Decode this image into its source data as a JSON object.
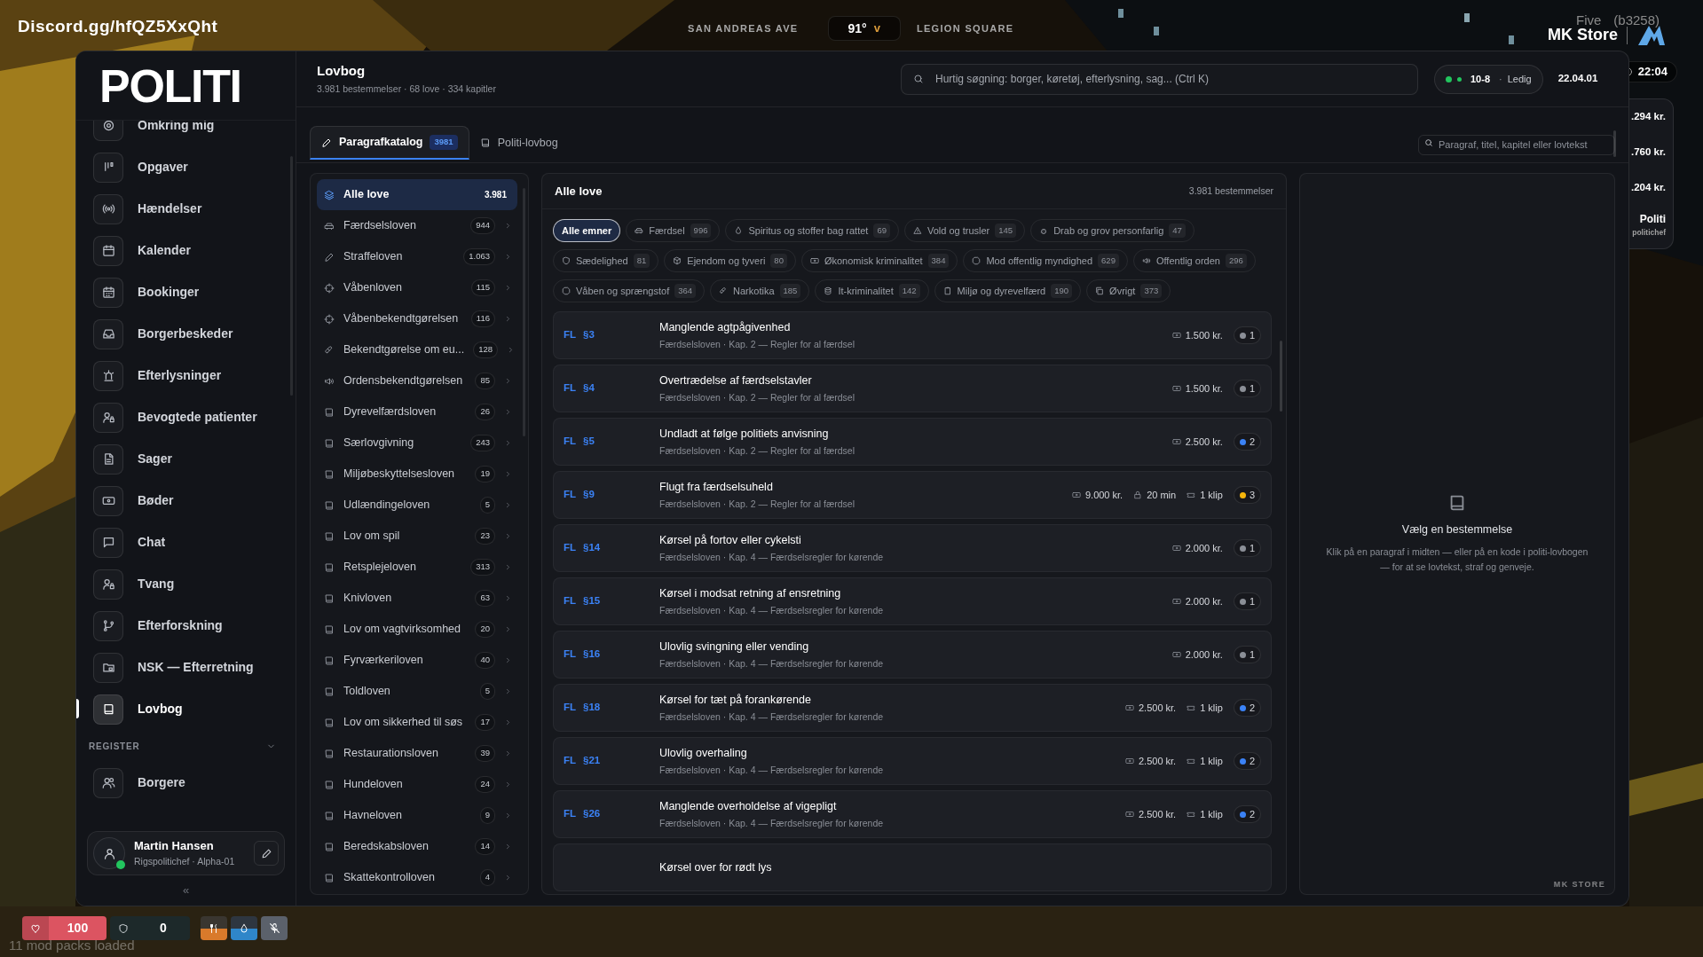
{
  "hud": {
    "server_link": "Discord.gg/hfQZ5XxQht",
    "street": "SAN ANDREAS AVE",
    "temperature": "91°",
    "temperature_unit": "v",
    "zone": "LEGION SQUARE",
    "client_name_fragment": "Five",
    "client_build": "(b3258)",
    "store_name": "MK Store",
    "clock": "22:04",
    "side_cards": [
      ".294 kr.",
      ".760 kr.",
      ".204 kr."
    ],
    "side_profile": {
      "name": "Politi",
      "role": "politichef"
    },
    "vitals": [
      {
        "kind": "health",
        "value": "100"
      },
      {
        "kind": "armor",
        "value": "0"
      },
      {
        "kind": "hunger"
      },
      {
        "kind": "thirst"
      },
      {
        "kind": "voice"
      }
    ],
    "loader_status": "11 mod packs loaded"
  },
  "sidebar": {
    "logo": "POLITI",
    "items": [
      {
        "label": "Omkring mig",
        "selected": false
      },
      {
        "label": "Opgaver",
        "selected": false
      },
      {
        "label": "Hændelser",
        "selected": false
      },
      {
        "label": "Kalender",
        "selected": false
      },
      {
        "label": "Bookinger",
        "selected": false
      },
      {
        "label": "Borgerbeskeder",
        "selected": false
      },
      {
        "label": "Efterlysninger",
        "selected": false
      },
      {
        "label": "Bevogtede patienter",
        "selected": false
      },
      {
        "label": "Sager",
        "selected": false
      },
      {
        "label": "Bøder",
        "selected": false
      },
      {
        "label": "Chat",
        "selected": false
      },
      {
        "label": "Tvang",
        "selected": false
      },
      {
        "label": "Efterforskning",
        "selected": false
      },
      {
        "label": "NSK — Efterretning",
        "selected": false
      },
      {
        "label": "Lovbog",
        "selected": true
      }
    ],
    "section": {
      "title": "REGISTER",
      "expanded": true,
      "items": [
        {
          "label": "Borgere",
          "selected": false
        }
      ]
    },
    "user": {
      "name": "Martin Hansen",
      "role": "Rigspolitichef · Alpha-01",
      "online": true
    },
    "collapse": "«"
  },
  "header": {
    "title": "Lovbog",
    "subtitle": "3.981 bestemmelser · 68 love · 334 kapitler",
    "search": {
      "placeholder": "Hurtig søgning: borger, køretøj, efterlysning, sag... (Ctrl K)"
    },
    "status": {
      "code": "10-8",
      "separator": "·",
      "label": "Ledig",
      "online": true
    },
    "date": "22.04.01"
  },
  "tabs": [
    {
      "label": "Paragrafkatalog",
      "count": "3981",
      "selected": true
    },
    {
      "label": "Politi-lovbog",
      "selected": false
    }
  ],
  "catalog_search": {
    "placeholder": "Paragraf, titel, kapitel eller lovtekst"
  },
  "laws": [
    {
      "label": "Alle love",
      "count": "3.981",
      "selected": true
    },
    {
      "label": "Færdselsloven",
      "count": "944",
      "selected": false
    },
    {
      "label": "Straffeloven",
      "count": "1.063",
      "selected": false
    },
    {
      "label": "Våbenloven",
      "count": "115",
      "selected": false
    },
    {
      "label": "Våbenbekendtgørelsen",
      "count": "116",
      "selected": false
    },
    {
      "label": "Bekendtgørelse om eu...",
      "count": "128",
      "selected": false
    },
    {
      "label": "Ordensbekendtgørelsen",
      "count": "85",
      "selected": false
    },
    {
      "label": "Dyrevelfærdsloven",
      "count": "26",
      "selected": false
    },
    {
      "label": "Særlovgivning",
      "count": "243",
      "selected": false
    },
    {
      "label": "Miljøbeskyttelsesloven",
      "count": "19",
      "selected": false
    },
    {
      "label": "Udlændingeloven",
      "count": "5",
      "selected": false
    },
    {
      "label": "Lov om spil",
      "count": "23",
      "selected": false
    },
    {
      "label": "Retsplejeloven",
      "count": "313",
      "selected": false
    },
    {
      "label": "Knivloven",
      "count": "63",
      "selected": false
    },
    {
      "label": "Lov om vagtvirksomhed",
      "count": "20",
      "selected": false
    },
    {
      "label": "Fyrværkeriloven",
      "count": "40",
      "selected": false
    },
    {
      "label": "Toldloven",
      "count": "5",
      "selected": false
    },
    {
      "label": "Lov om sikkerhed til søs",
      "count": "17",
      "selected": false
    },
    {
      "label": "Restaurationsloven",
      "count": "39",
      "selected": false
    },
    {
      "label": "Hundeloven",
      "count": "24",
      "selected": false
    },
    {
      "label": "Havneloven",
      "count": "9",
      "selected": false
    },
    {
      "label": "Beredskabsloven",
      "count": "14",
      "selected": false
    },
    {
      "label": "Skattekontrolloven",
      "count": "4",
      "selected": false
    }
  ],
  "list": {
    "title": "Alle love",
    "total": "3.981 bestemmelser",
    "topics": [
      {
        "label": "Alle emner",
        "selected": true
      },
      {
        "label": "Færdsel",
        "count": "996",
        "selected": false
      },
      {
        "label": "Spiritus og stoffer bag rattet",
        "count": "69",
        "selected": false
      },
      {
        "label": "Vold og trusler",
        "count": "145",
        "selected": false
      },
      {
        "label": "Drab og grov personfarlig",
        "count": "47",
        "selected": false
      },
      {
        "label": "Sædelighed",
        "count": "81",
        "selected": false
      },
      {
        "label": "Ejendom og tyveri",
        "count": "80",
        "selected": false
      },
      {
        "label": "Økonomisk kriminalitet",
        "count": "384",
        "selected": false
      },
      {
        "label": "Mod offentlig myndighed",
        "count": "629",
        "selected": false
      },
      {
        "label": "Offentlig orden",
        "count": "296",
        "selected": false
      },
      {
        "label": "Våben og sprængstof",
        "count": "364",
        "selected": false
      },
      {
        "label": "Narkotika",
        "count": "185",
        "selected": false
      },
      {
        "label": "It-kriminalitet",
        "count": "142",
        "selected": false
      },
      {
        "label": "Miljø og dyrevelfærd",
        "count": "190",
        "selected": false
      },
      {
        "label": "Øvrigt",
        "count": "373",
        "selected": false
      }
    ],
    "provisions": [
      {
        "law": "FL",
        "section": "§3",
        "title": "Manglende agtpågivenhed",
        "chapter": "Færdselsloven · Kap. 2 — Regler for al færdsel",
        "fine": "1.500 kr.",
        "severity": "1",
        "color": "#8b8f97"
      },
      {
        "law": "FL",
        "section": "§4",
        "title": "Overtrædelse af færdselstavler",
        "chapter": "Færdselsloven · Kap. 2 — Regler for al færdsel",
        "fine": "1.500 kr.",
        "severity": "1",
        "color": "#8b8f97"
      },
      {
        "law": "FL",
        "section": "§5",
        "title": "Undladt at følge politiets anvisning",
        "chapter": "Færdselsloven · Kap. 2 — Regler for al færdsel",
        "fine": "2.500 kr.",
        "severity": "2",
        "color": "#3b82f6"
      },
      {
        "law": "FL",
        "section": "§9",
        "title": "Flugt fra færdselsuheld",
        "chapter": "Færdselsloven · Kap. 2 — Regler for al færdsel",
        "fine": "9.000 kr.",
        "jail": "20 min",
        "clip": "1 klip",
        "severity": "3",
        "color": "#f5b50b"
      },
      {
        "law": "FL",
        "section": "§14",
        "title": "Kørsel på fortov eller cykelsti",
        "chapter": "Færdselsloven · Kap. 4 — Færdselsregler for kørende",
        "fine": "2.000 kr.",
        "severity": "1",
        "color": "#8b8f97"
      },
      {
        "law": "FL",
        "section": "§15",
        "title": "Kørsel i modsat retning af ensretning",
        "chapter": "Færdselsloven · Kap. 4 — Færdselsregler for kørende",
        "fine": "2.000 kr.",
        "severity": "1",
        "color": "#8b8f97"
      },
      {
        "law": "FL",
        "section": "§16",
        "title": "Ulovlig svingning eller vending",
        "chapter": "Færdselsloven · Kap. 4 — Færdselsregler for kørende",
        "fine": "2.000 kr.",
        "severity": "1",
        "color": "#8b8f97"
      },
      {
        "law": "FL",
        "section": "§18",
        "title": "Kørsel for tæt på forankørende",
        "chapter": "Færdselsloven · Kap. 4 — Færdselsregler for kørende",
        "fine": "2.500 kr.",
        "clip": "1 klip",
        "severity": "2",
        "color": "#3b82f6"
      },
      {
        "law": "FL",
        "section": "§21",
        "title": "Ulovlig overhaling",
        "chapter": "Færdselsloven · Kap. 4 — Færdselsregler for kørende",
        "fine": "2.500 kr.",
        "clip": "1 klip",
        "severity": "2",
        "color": "#3b82f6"
      },
      {
        "law": "FL",
        "section": "§26",
        "title": "Manglende overholdelse af vigepligt",
        "chapter": "Færdselsloven · Kap. 4 — Færdselsregler for kørende",
        "fine": "2.500 kr.",
        "clip": "1 klip",
        "severity": "2",
        "color": "#3b82f6"
      },
      {
        "title": "Kørsel over for rødt lys"
      }
    ]
  },
  "detail": {
    "title": "Vælg en bestemmelse",
    "text": "Klik på en paragraf i midten — eller på en kode i politi-lovbogen — for at se lovtekst, straf og genveje.",
    "brand": "MK STORE"
  }
}
